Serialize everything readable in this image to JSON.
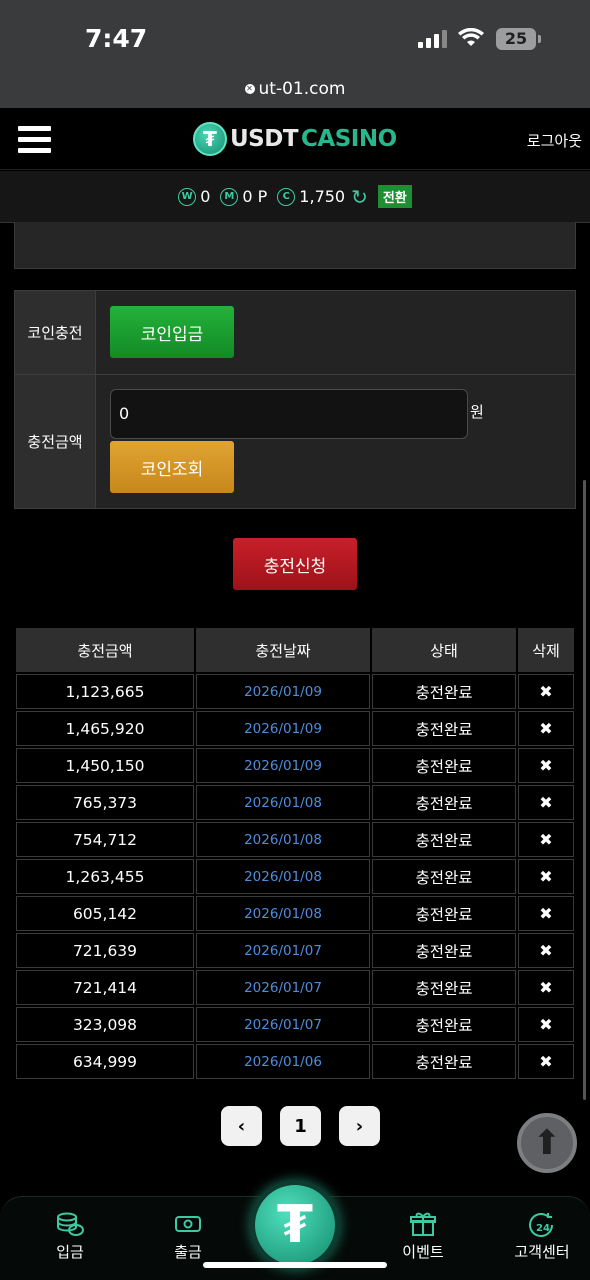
{
  "status": {
    "time": "7:47",
    "battery": "25"
  },
  "browser": {
    "url": "ut-01.com"
  },
  "header": {
    "logo_usdt": "USDT",
    "logo_casino": "CASINO",
    "logout": "로그아웃"
  },
  "balance": {
    "won_icon": "W",
    "won": "0",
    "mileage_icon": "M",
    "mileage": "0 P",
    "coin_icon": "C",
    "coin": "1,750",
    "switch": "전환"
  },
  "form": {
    "coin_charge_label": "코인충전",
    "coin_deposit_button": "코인입금",
    "amount_label": "충전금액",
    "amount_value": "0",
    "amount_unit": "원",
    "coin_check_button": "코인조회",
    "submit_button": "충전신청"
  },
  "history": {
    "columns": [
      "충전금액",
      "충전날짜",
      "상태",
      "삭제"
    ],
    "delete_symbol": "✖",
    "rows": [
      {
        "amount": "1,123,665",
        "date": "2026/01/09",
        "status": "충전완료"
      },
      {
        "amount": "1,465,920",
        "date": "2026/01/09",
        "status": "충전완료"
      },
      {
        "amount": "1,450,150",
        "date": "2026/01/09",
        "status": "충전완료"
      },
      {
        "amount": "765,373",
        "date": "2026/01/08",
        "status": "충전완료"
      },
      {
        "amount": "754,712",
        "date": "2026/01/08",
        "status": "충전완료"
      },
      {
        "amount": "1,263,455",
        "date": "2026/01/08",
        "status": "충전완료"
      },
      {
        "amount": "605,142",
        "date": "2026/01/08",
        "status": "충전완료"
      },
      {
        "amount": "721,639",
        "date": "2026/01/07",
        "status": "충전완료"
      },
      {
        "amount": "721,414",
        "date": "2026/01/07",
        "status": "충전완료"
      },
      {
        "amount": "323,098",
        "date": "2026/01/07",
        "status": "충전완료"
      },
      {
        "amount": "634,999",
        "date": "2026/01/06",
        "status": "충전완료"
      }
    ]
  },
  "pagination": {
    "prev": "‹",
    "page": "1",
    "next": "›"
  },
  "bottom_nav": {
    "items": [
      {
        "label": "입금",
        "icon": "coins-icon"
      },
      {
        "label": "출금",
        "icon": "cash-icon"
      },
      {
        "label": "이벤트",
        "icon": "gift-icon"
      },
      {
        "label": "고객센터",
        "icon": "support-24-icon"
      }
    ]
  },
  "colors": {
    "accent": "#3ec9a0",
    "green_button": "#1d8e31",
    "gold_button": "#d4951f",
    "red_button": "#b0161f",
    "date_text": "#4f8ddb"
  }
}
